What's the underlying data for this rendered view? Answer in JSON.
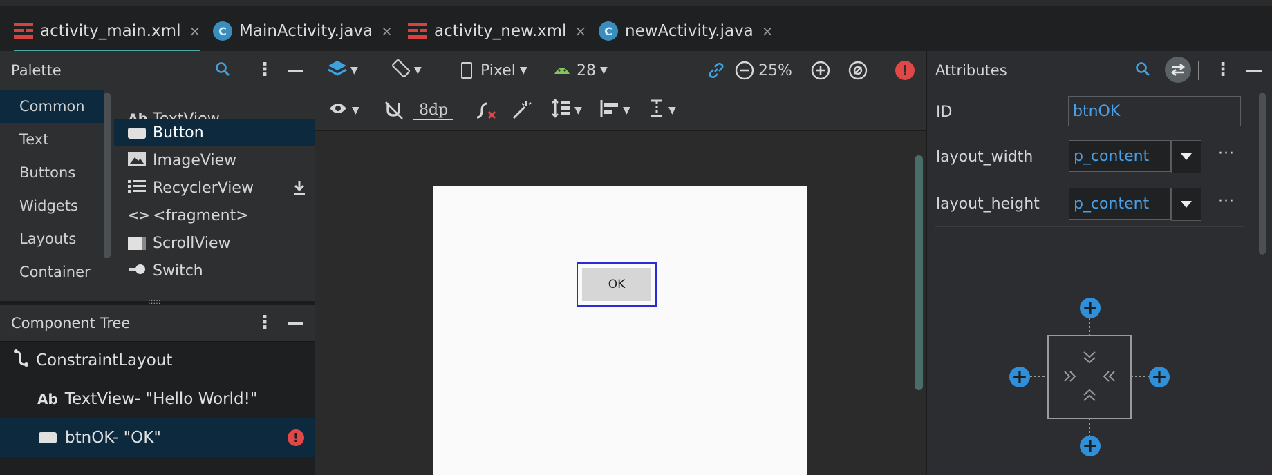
{
  "tabs": [
    {
      "label": "activity_main.xml",
      "type": "xml",
      "active": true
    },
    {
      "label": "MainActivity.java",
      "type": "java",
      "active": false
    },
    {
      "label": "activity_new.xml",
      "type": "xml",
      "active": false
    },
    {
      "label": "newActivity.java",
      "type": "java",
      "active": false
    }
  ],
  "tab_close": "×",
  "java_icon_letter": "C",
  "palette": {
    "title": "Palette",
    "categories": [
      "Common",
      "Text",
      "Buttons",
      "Widgets",
      "Layouts",
      "Container"
    ],
    "items": [
      {
        "label": "TextView",
        "icon": "Ab"
      },
      {
        "label": "Button",
        "icon": "button-icon"
      },
      {
        "label": "ImageView",
        "icon": "image-icon"
      },
      {
        "label": "RecyclerView",
        "icon": "list-icon"
      },
      {
        "label": "<fragment>",
        "icon": "<>"
      },
      {
        "label": "ScrollView",
        "icon": "scrollview-icon"
      },
      {
        "label": "Switch",
        "icon": "switch-icon"
      }
    ],
    "divider": ":::::"
  },
  "tree": {
    "title": "Component Tree",
    "rows": [
      {
        "label": "ConstraintLayout",
        "icon": "constraint-icon"
      },
      {
        "icon": "Ab",
        "label": "TextView- \"Hello World!\""
      },
      {
        "label": "btnOK- \"OK\"",
        "icon": "button-icon",
        "error": true
      }
    ]
  },
  "toolbar": {
    "device": "Pixel",
    "api": "28",
    "zoom": "25%",
    "margin": "8dp"
  },
  "canvas": {
    "button_text": "OK"
  },
  "attributes": {
    "title": "Attributes",
    "id_label": "ID",
    "id_value": "btnOK",
    "layout_width_label": "layout_width",
    "layout_width_value": "p_content",
    "layout_height_label": "layout_height",
    "layout_height_value": "p_content",
    "more": "···"
  },
  "colors": {
    "accent": "#4aa7a3",
    "selection": "#0d293e",
    "link": "#4aa0e8",
    "error": "#e04848",
    "constraint_plus": "#2f8fd8"
  }
}
